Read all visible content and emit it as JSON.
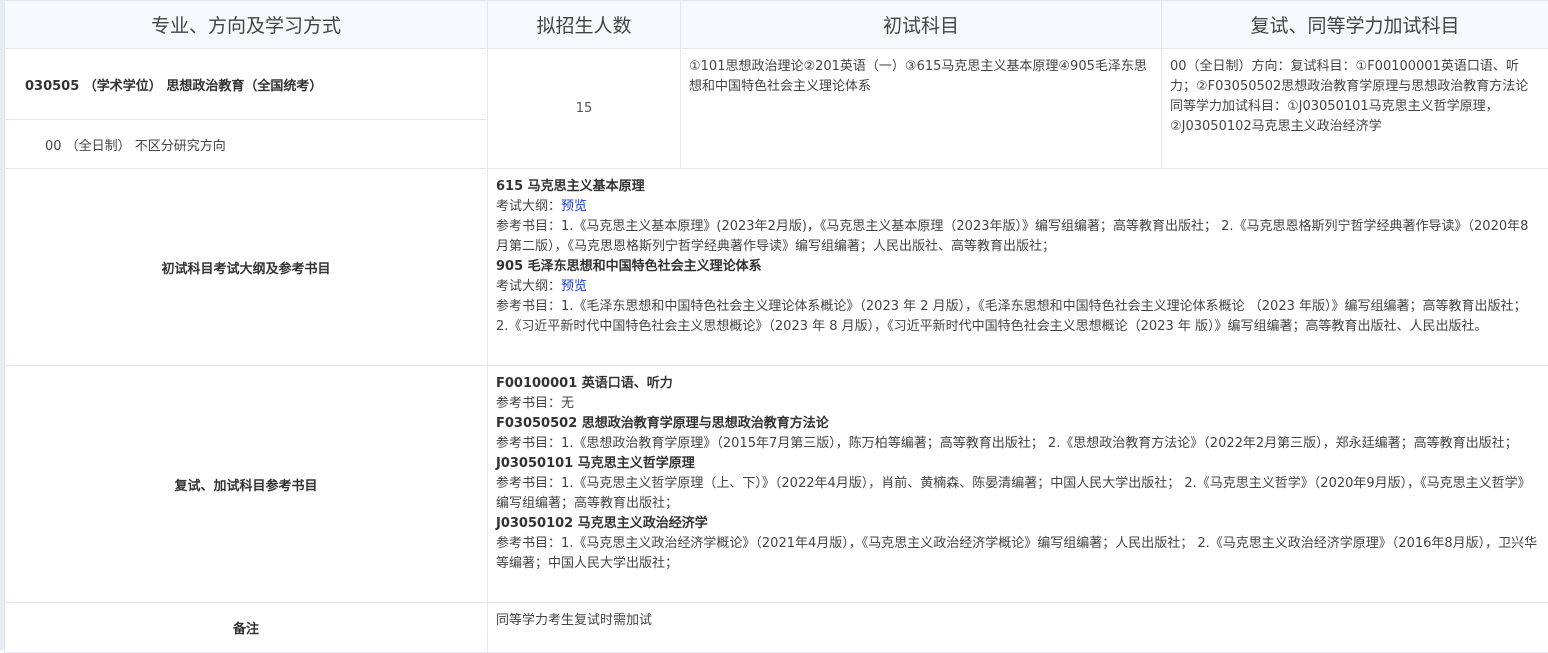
{
  "header": {
    "col1": "专业、方向及学习方式",
    "col2": "拟招生人数",
    "col3": "初试科目",
    "col4": "复试、同等学力加试科目"
  },
  "row1": {
    "major": "030505 （学术学位） 思想政治教育（全国统考）",
    "direction": "00 （全日制） 不区分研究方向",
    "count": "15",
    "initial_subjects": "①101思想政治理论②201英语（一）③615马克思主义基本原理④905毛泽东思想和中国特色社会主义理论体系",
    "retest_line1": "00（全日制）方向：复试科目：①F00100001英语口语、听力；②F03050502思想政治教育学原理与思想政治教育方法论",
    "retest_line2": "同等学力加试科目：①J03050101马克思主义哲学原理，②J03050102马克思主义政治经济学"
  },
  "row2": {
    "label": "初试科目考试大纲及参考书目",
    "s1_title": "615 马克思主义基本原理",
    "s1_outline_label": "考试大纲：",
    "s1_outline_link": "预览",
    "s1_books": "参考书目：1.《马克思主义基本原理》(2023年2月版)，《马克思主义基本原理（2023年版）》编写组编著；高等教育出版社； 2.《马克思恩格斯列宁哲学经典著作导读》（2020年8月第二版），《马克思恩格斯列宁哲学经典著作导读》编写组编著；人民出版社、高等教育出版社；",
    "s2_title": "905 毛泽东思想和中国特色社会主义理论体系",
    "s2_outline_label": "考试大纲：",
    "s2_outline_link": "预览",
    "s2_books": "参考书目：1.《毛泽东思想和中国特色社会主义理论体系概论》（2023 年 2 月版），《毛泽东思想和中国特色社会主义理论体系概论 （2023 年版）》编写组编著；高等教育出版社； 2.《习近平新时代中国特色社会主义思想概论》（2023 年 8 月版），《习近平新时代中国特色社会主义思想概论（2023 年 版）》编写组编著；高等教育出版社、人民出版社。"
  },
  "row3": {
    "label": "复试、加试科目参考书目",
    "r1_title": "F00100001 英语口语、听力",
    "r1_books": "参考书目：无",
    "r2_title": "F03050502 思想政治教育学原理与思想政治教育方法论",
    "r2_books": "参考书目：1.《思想政治教育学原理》（2015年7月第三版），陈万柏等编著；高等教育出版社； 2.《思想政治教育方法论》（2022年2月第三版），郑永廷编著；高等教育出版社；",
    "r3_title": "J03050101 马克思主义哲学原理",
    "r3_books": "参考书目：1.《马克思主义哲学原理（上、下）》（2022年4月版），肖前、黄楠森、陈晏清编著；中国人民大学出版社； 2.《马克思主义哲学》（2020年9月版），《马克思主义哲学》编写组编著；高等教育出版社；",
    "r4_title": "J03050102 马克思主义政治经济学",
    "r4_books": "参考书目：1.《马克思主义政治经济学概论》（2021年4月版），《马克思主义政治经济学概论》编写组编著；人民出版社； 2.《马克思主义政治经济学原理》（2016年8月版），卫兴华等编著；中国人民大学出版社；"
  },
  "row4": {
    "label": "备注",
    "note": "同等学力考生复试时需加试"
  }
}
